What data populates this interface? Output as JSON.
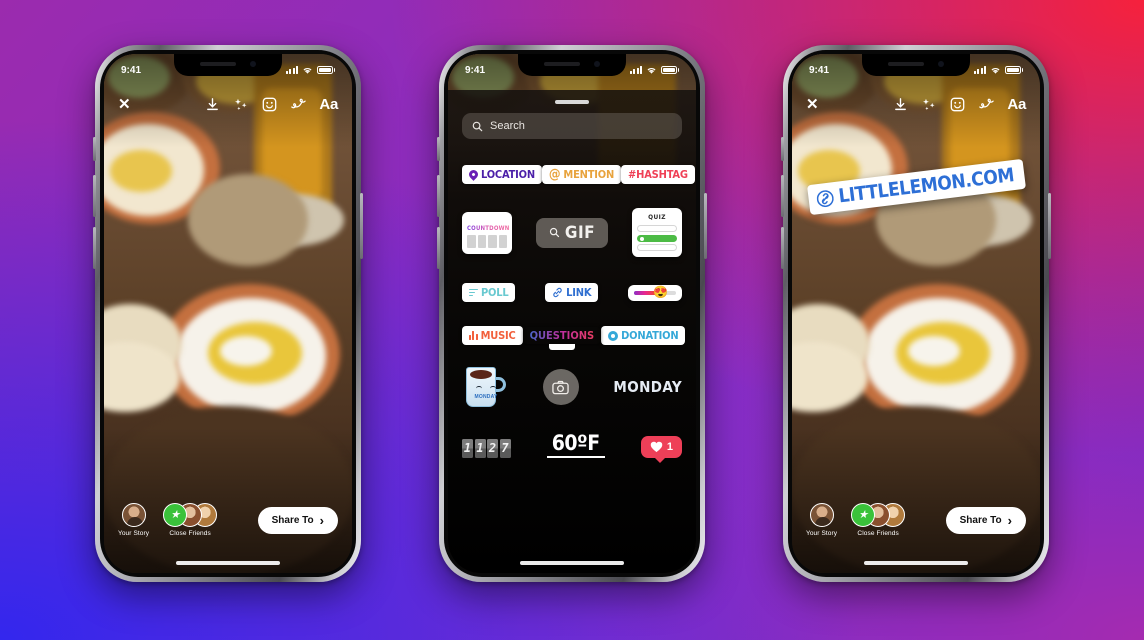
{
  "background": {
    "colors": [
      "#9b2bae",
      "#f6213c",
      "#3327ee",
      "#a52bb0"
    ]
  },
  "status_bar": {
    "time": "9:41",
    "signal_icon": "cellular-signal-icon",
    "wifi_icon": "wifi-icon",
    "battery_icon": "battery-icon"
  },
  "toolbar": {
    "close_label": "✕",
    "items": [
      {
        "name": "download-icon",
        "label": ""
      },
      {
        "name": "sparkles-icon",
        "label": ""
      },
      {
        "name": "sticker-smiley-icon",
        "label": ""
      },
      {
        "name": "draw-squiggle-icon",
        "label": ""
      },
      {
        "name": "text-tool-icon",
        "label": "Aa"
      }
    ]
  },
  "share_bar": {
    "your_story_label": "Your Story",
    "close_friends_label": "Close Friends",
    "share_button_label": "Share To",
    "share_button_chevron": "›"
  },
  "sticker_tray": {
    "search_placeholder": "Search",
    "search_icon": "search-icon",
    "grab_handle": "",
    "rows": [
      {
        "items": [
          {
            "name": "sticker-location",
            "label": "LOCATION",
            "color": "#4b1fa8"
          },
          {
            "name": "sticker-mention",
            "label": "MENTION",
            "prefix": "@",
            "color": "#e8a33d"
          },
          {
            "name": "sticker-hashtag",
            "label": "#HASHTAG",
            "color": "#ef4056"
          }
        ]
      },
      {
        "items": [
          {
            "name": "sticker-countdown",
            "label": "COUNTDOWN"
          },
          {
            "name": "sticker-gif",
            "label": "GIF"
          },
          {
            "name": "sticker-quiz",
            "label": "QUIZ"
          }
        ]
      },
      {
        "items": [
          {
            "name": "sticker-poll",
            "label": "POLL",
            "color": "#69c9d0"
          },
          {
            "name": "sticker-link",
            "label": "LINK",
            "color": "#2f6fd0"
          },
          {
            "name": "sticker-emoji-slider",
            "label": "",
            "emoji": "😍"
          }
        ]
      },
      {
        "items": [
          {
            "name": "sticker-music",
            "label": "MUSIC",
            "color": "#f2603c"
          },
          {
            "name": "sticker-questions",
            "label": "QUESTIONS"
          },
          {
            "name": "sticker-donation",
            "label": "DONATION",
            "color": "#35a8d8"
          }
        ]
      },
      {
        "items": [
          {
            "name": "sticker-monday-mug",
            "label": "MONDAY"
          },
          {
            "name": "sticker-camera",
            "label": ""
          },
          {
            "name": "sticker-monday-text",
            "label": "MONDAY"
          }
        ]
      }
    ],
    "bottom_row": {
      "flip_clock_digits": [
        "1",
        "1",
        "2",
        "7"
      ],
      "temperature": "60ºF",
      "heart_count": "1",
      "heart_icon": "heart-icon"
    }
  },
  "link_sticker": {
    "url_label": "LITTLELEMON.COM",
    "icon": "link-chain-icon",
    "color": "#2d6fd6"
  },
  "photo": {
    "alt": "mezze-table-hummus-labneh-tea"
  }
}
